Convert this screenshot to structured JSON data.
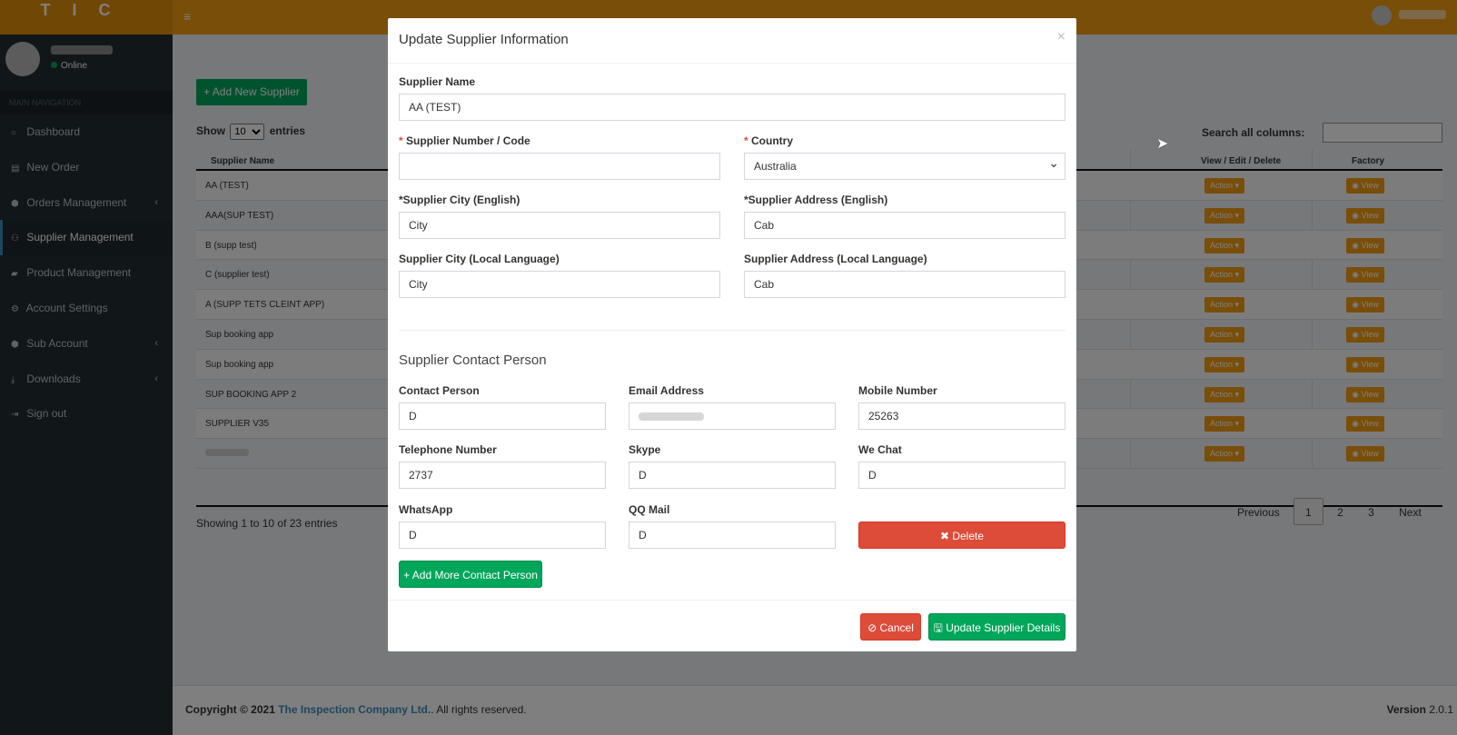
{
  "header": {
    "logo_text": "TIC",
    "menu_icon": "hamburger-icon"
  },
  "sidebar": {
    "user_status": "Online",
    "nav_header": "MAIN NAVIGATION",
    "items": [
      {
        "label": "Dashboard",
        "icon": "circle-icon",
        "caret": ""
      },
      {
        "label": "New Order",
        "icon": "file-icon",
        "caret": ""
      },
      {
        "label": "Orders Management",
        "icon": "cube-icon",
        "caret": "‹"
      },
      {
        "label": "Supplier Management",
        "icon": "handshake-icon",
        "caret": ""
      },
      {
        "label": "Product Management",
        "icon": "folder-icon",
        "caret": ""
      },
      {
        "label": "Account Settings",
        "icon": "gear-icon",
        "caret": ""
      },
      {
        "label": "Sub Account",
        "icon": "cube-icon",
        "caret": "‹"
      },
      {
        "label": "Downloads",
        "icon": "download-icon",
        "caret": "‹"
      },
      {
        "label": "Sign out",
        "icon": "sign-out-icon",
        "caret": ""
      }
    ]
  },
  "page": {
    "add_button": "+ Add New Supplier",
    "show": "Show",
    "entries_value": "10",
    "entries": "entries",
    "search_label": "Search all columns:",
    "columns": {
      "name": "Supplier Name",
      "actions": "View / Edit / Delete",
      "factory": "Factory"
    },
    "rows": [
      {
        "name": "AA (TEST)"
      },
      {
        "name": "AAA(SUP TEST)"
      },
      {
        "name": "B (supp test)"
      },
      {
        "name": "C (supplier test)"
      },
      {
        "name": "A (SUPP TETS CLEINT APP)"
      },
      {
        "name": "Sup booking app"
      },
      {
        "name": "Sup booking app"
      },
      {
        "name": "SUP BOOKING APP 2"
      },
      {
        "name": "SUPPLIER V35"
      },
      {
        "name": ""
      }
    ],
    "action_label": "Action ▾",
    "view_label": "View",
    "showing": "Showing 1 to 10 of 23 entries",
    "pager": {
      "previous": "Previous",
      "p1": "1",
      "p2": "2",
      "p3": "3",
      "next": "Next"
    }
  },
  "footer": {
    "copyright_prefix": "Copyright © 2021",
    "company": "The Inspection Company Ltd.",
    "rights": ". All rights reserved.",
    "version_label": "Version",
    "version": "2.0.1"
  },
  "modal": {
    "title": "Update Supplier Information",
    "close": "×",
    "supplier_name_label": "Supplier Name",
    "supplier_name": "AA (TEST)",
    "supplier_number_label": "Supplier Number / Code",
    "supplier_number": "",
    "country_label": "Country",
    "country": "Australia",
    "city_en_label": "*Supplier City (English)",
    "city_en": "City",
    "address_en_label": "*Supplier Address (English)",
    "address_en": "Cab",
    "city_local_label": "Supplier City (Local Language)",
    "city_local": "City",
    "address_local_label": "Supplier Address (Local Language)",
    "address_local": "Cab",
    "contact_section": "Supplier Contact Person",
    "contact_person_label": "Contact Person",
    "contact_person": "D",
    "email_label": "Email Address",
    "mobile_label": "Mobile Number",
    "mobile": "25263",
    "telephone_label": "Telephone Number",
    "telephone": "2737",
    "skype_label": "Skype",
    "skype": "D",
    "wechat_label": "We Chat",
    "wechat": "D",
    "whatsapp_label": "WhatsApp",
    "whatsapp": "D",
    "qq_label": "QQ Mail",
    "qq": "D",
    "delete_button": "✖ Delete",
    "add_contact_button": "+ Add More Contact Person",
    "cancel_button": "⊘ Cancel",
    "update_button": "Update Supplier Details"
  },
  "colors": {
    "header": "#f39c12",
    "sidebar": "#222d32",
    "success": "#00a65a",
    "danger": "#dd4b39",
    "link": "#3c8dbc"
  }
}
